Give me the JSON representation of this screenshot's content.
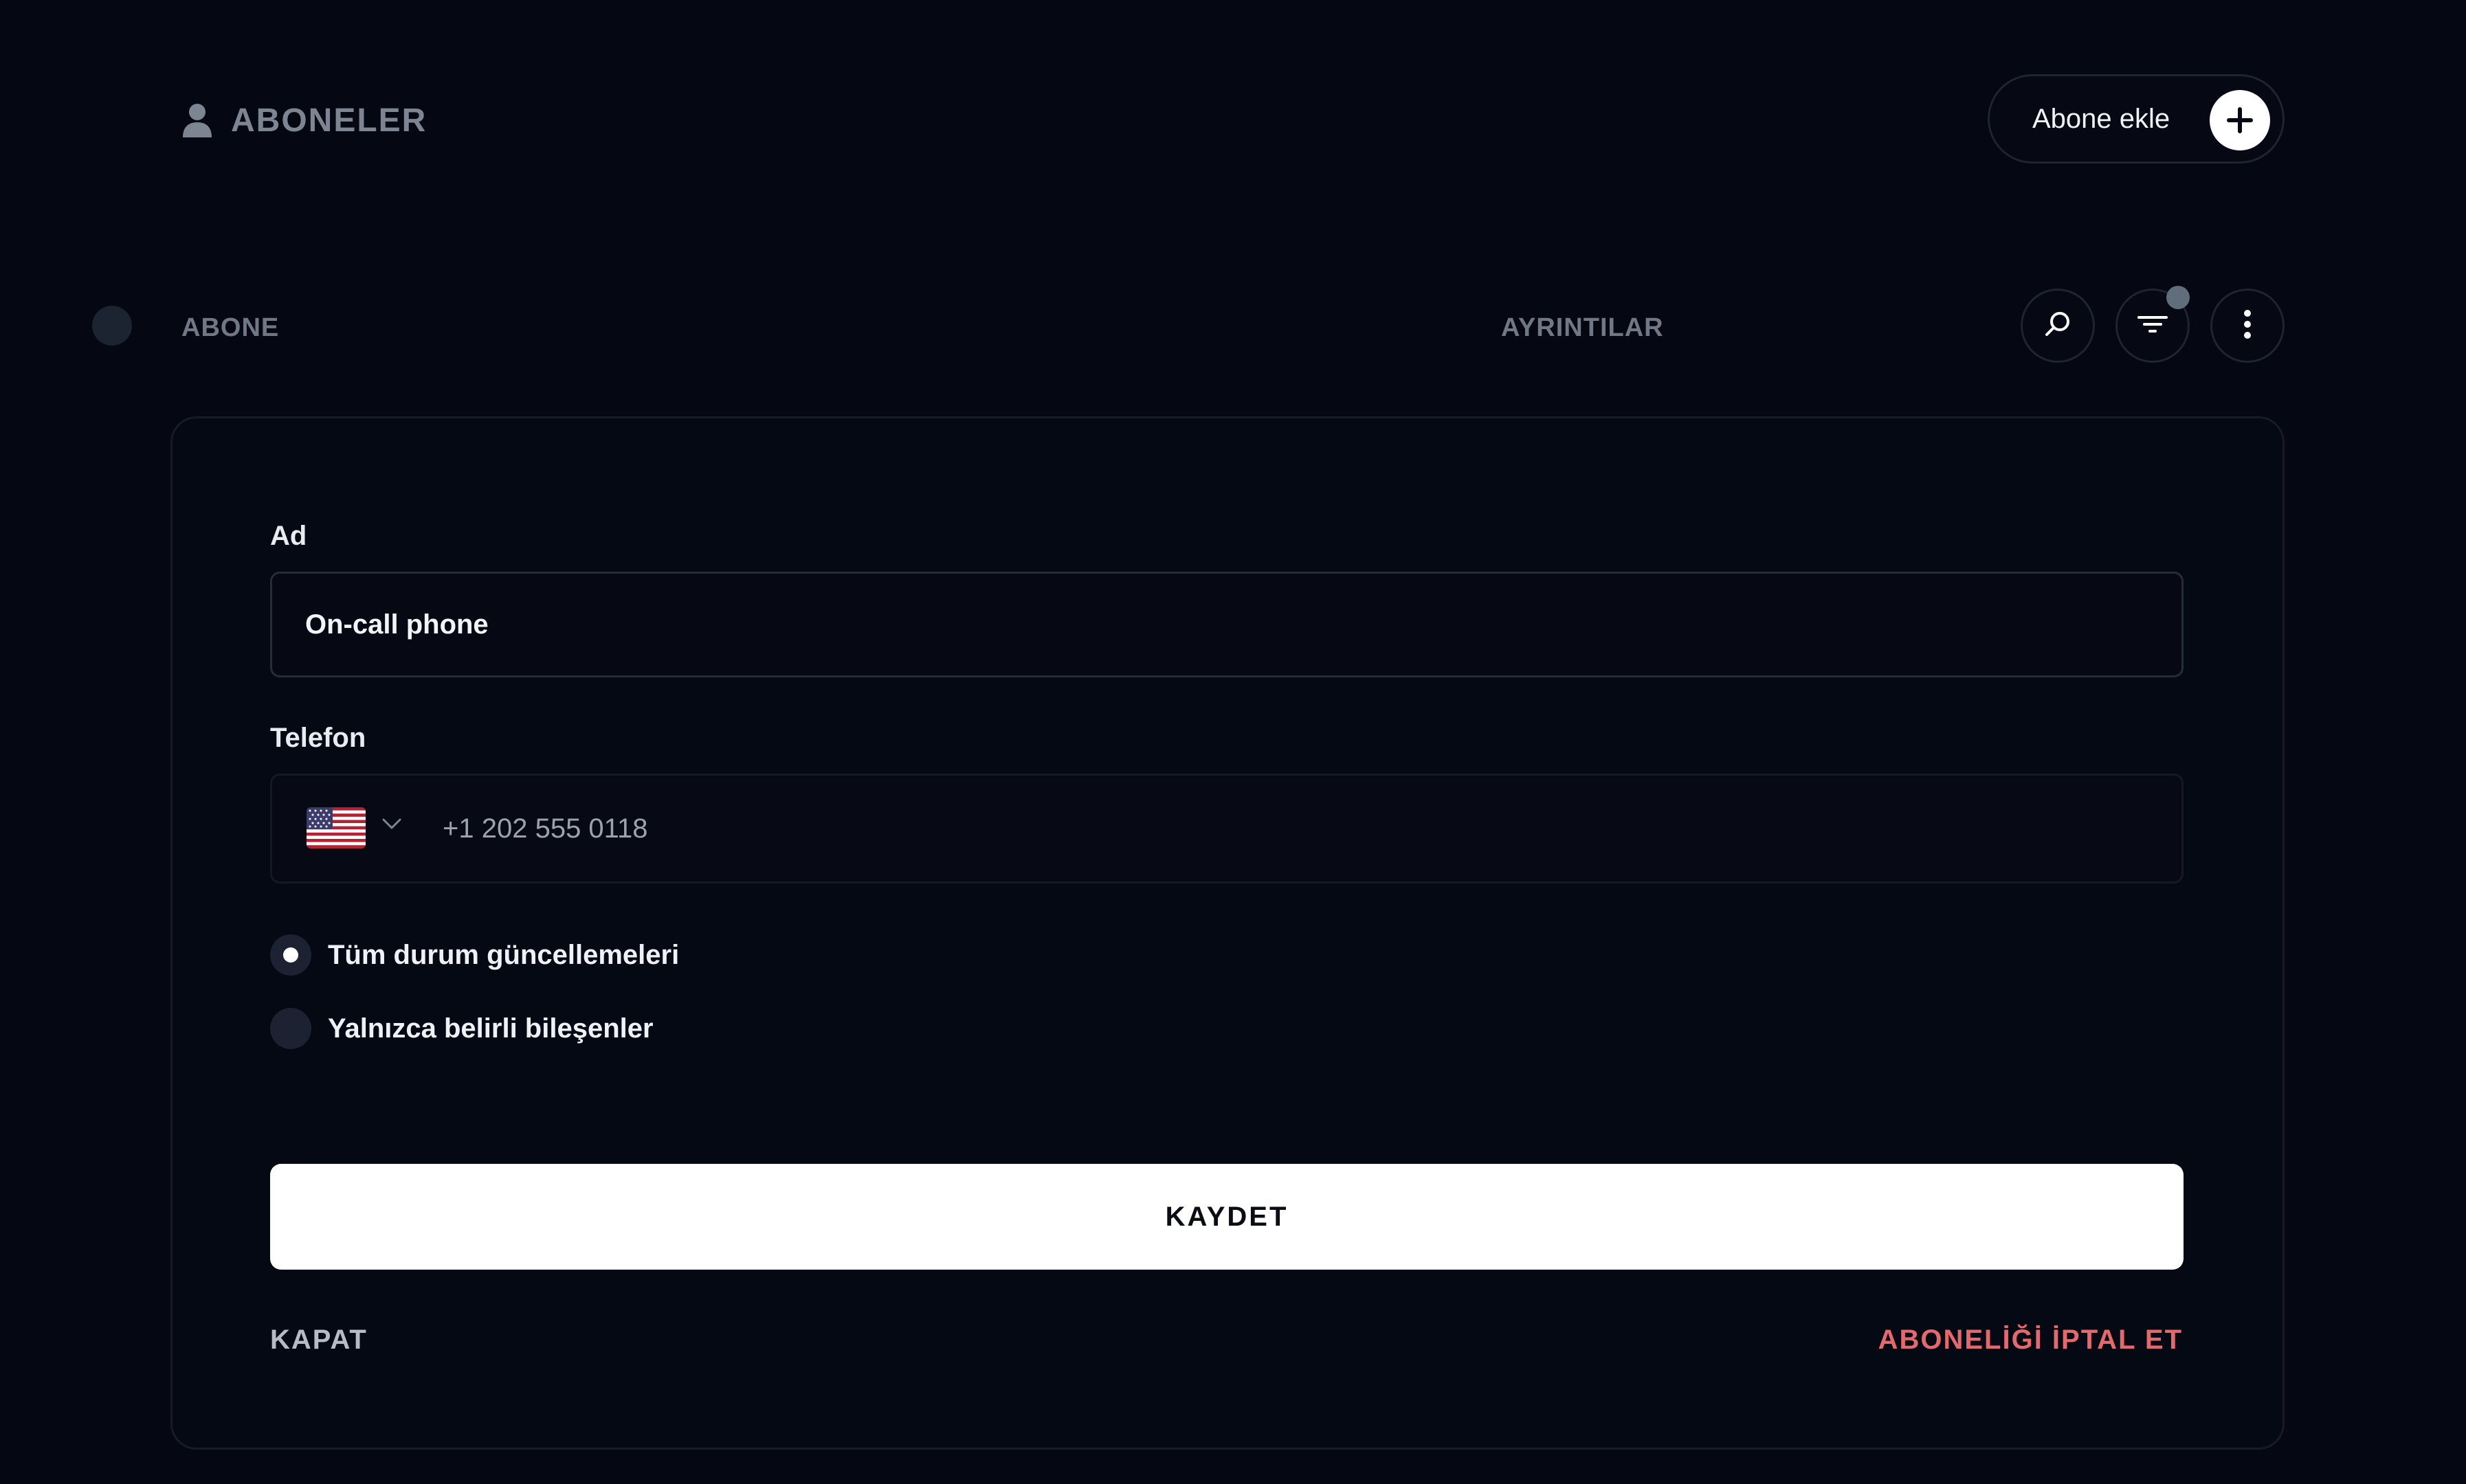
{
  "header": {
    "title": "ABONELER",
    "add_button_label": "Abone ekle"
  },
  "columns": {
    "subscriber": "ABONE",
    "details": "AYRINTILAR"
  },
  "toolbar": {
    "icons": [
      "search-icon",
      "filter-icon",
      "more-icon"
    ],
    "filter_badge_color": "#5f6e7a"
  },
  "form": {
    "name_label": "Ad",
    "name_value": "On-call phone",
    "phone_label": "Telefon",
    "phone_country": "US",
    "phone_value": "+1 202 555 0118",
    "radio_options": [
      {
        "label": "Tüm durum güncellemeleri",
        "selected": true
      },
      {
        "label": "Yalnızca belirli bileşenler",
        "selected": false
      }
    ],
    "save_label": "KAYDET",
    "close_label": "KAPAT",
    "unsubscribe_label": "ABONELİĞİ İPTAL ET"
  },
  "colors": {
    "background": "#050813",
    "accent_danger": "#e5686c",
    "primary_button": "#ffffff"
  }
}
